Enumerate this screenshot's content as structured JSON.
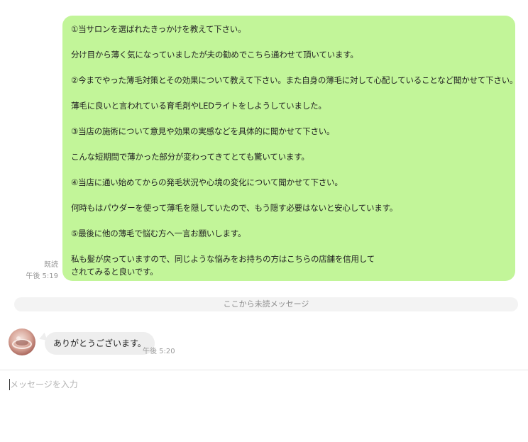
{
  "outgoing": {
    "read_label": "既読",
    "time": "午後 5:19",
    "lines": [
      "①当サロンを選ばれたきっかけを教えて下さい。",
      "",
      "分け目から薄く気になっていましたが夫の勧めでこちら通わせて頂いています。",
      "",
      "②今までやった薄毛対策とその効果について教えて下さい。また自身の薄毛に対して心配していることなど聞かせて下さい。",
      "",
      "薄毛に良いと言われている育毛剤やLEDライトをしようしていました。",
      "",
      "③当店の施術について意見や効果の実感などを具体的に聞かせて下さい。",
      "",
      "こんな短期間で薄かった部分が変わってきてとても驚いています。",
      "",
      "④当店に通い始めてからの発毛状況や心境の変化について聞かせて下さい。",
      "",
      "何時もはパウダーを使って薄毛を隠していたので、もう隠す必要はないと安心しています。",
      "",
      "⑤最後に他の薄毛で悩む方へ一言お願いします。",
      "",
      "私も髪が戻っていますので、同じような悩みをお持ちの方はこちらの店舗を信用して",
      "されてみると良いです。"
    ]
  },
  "unread_divider": "ここから未読メッセージ",
  "incoming": {
    "text": "ありがとうございます。",
    "time": "午後 5:20",
    "avatar_icon": "avatar-photo"
  },
  "composer": {
    "placeholder": "メッセージを入力",
    "value": ""
  },
  "colors": {
    "outgoing_bubble": "#c2f599",
    "incoming_bubble": "#eeeeee"
  }
}
